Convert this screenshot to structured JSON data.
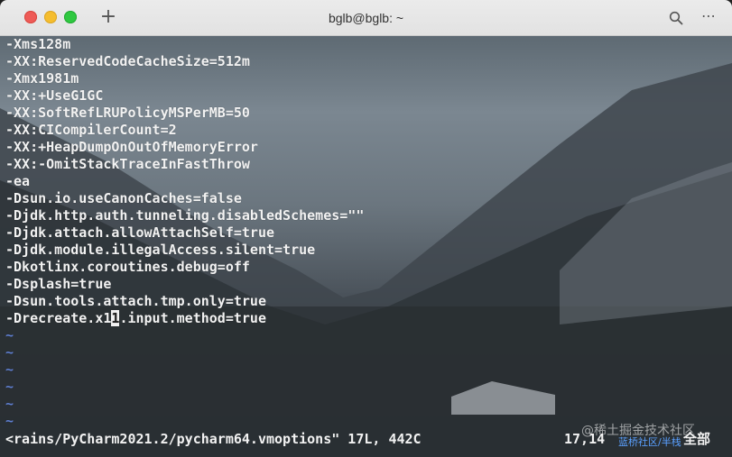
{
  "window": {
    "title": "bglb@bglb: ~",
    "new_tab_label": "+",
    "menu_label": "⋯"
  },
  "editor": {
    "lines": [
      "-Xms128m",
      "-XX:ReservedCodeCacheSize=512m",
      "-Xmx1981m",
      "-XX:+UseG1GC",
      "-XX:SoftRefLRUPolicyMSPerMB=50",
      "-XX:CICompilerCount=2",
      "-XX:+HeapDumpOnOutOfMemoryError",
      "-XX:-OmitStackTraceInFastThrow",
      "-ea",
      "-Dsun.io.useCanonCaches=false",
      "-Djdk.http.auth.tunneling.disabledSchemes=\"\"",
      "-Djdk.attach.allowAttachSelf=true",
      "-Djdk.module.illegalAccess.silent=true",
      "-Dkotlinx.coroutines.debug=off",
      "-Dsplash=true",
      "-Dsun.tools.attach.tmp.only=true"
    ],
    "cursor_line": {
      "before": "-Drecreate.x1",
      "cursor_char": "1",
      "after": ".input.method=true"
    },
    "tilde": "~",
    "tilde_count": 6
  },
  "status": {
    "file_info": "<rains/PyCharm2021.2/pycharm64.vmoptions\" 17L, 442C",
    "position": "17,14",
    "scroll": "全部"
  },
  "watermark": {
    "main": "@稀土掘金技术社区",
    "sub": "蓝桥社区/半栈"
  },
  "colors": {
    "text": "#f2f2f2",
    "tilde": "#5f7fd0",
    "close": "#ee5b57",
    "minimize": "#f5bd2e",
    "maximize": "#2fc840"
  }
}
